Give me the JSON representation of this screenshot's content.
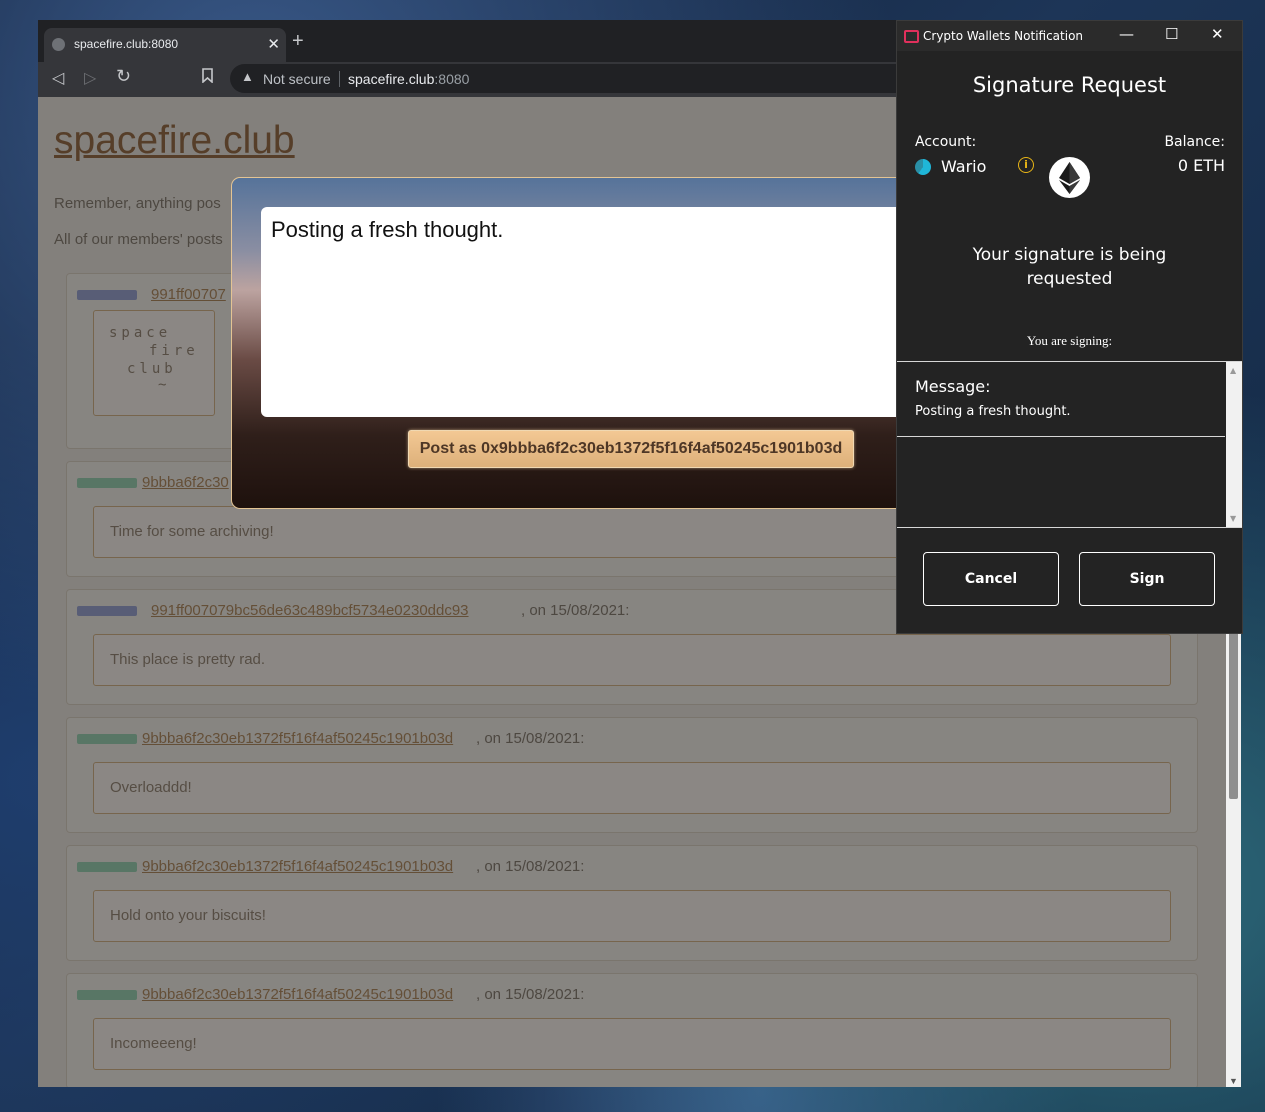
{
  "browser": {
    "tab_title": "spacefire.club:8080",
    "tab_close": "✕",
    "new_tab": "+",
    "not_secure": "Not secure",
    "url_host": "spacefire.club",
    "url_port": ":8080"
  },
  "site": {
    "title": "spacefire.club",
    "intro1": "Remember, anything pos",
    "intro2": "All of our members' posts"
  },
  "ascii_art": [
    "space",
    "fire",
    "club",
    "~"
  ],
  "posts": [
    {
      "address": "991ff00707",
      "date": "",
      "message": "",
      "avatar_color": "#8f97c7"
    },
    {
      "address": "9bbba6f2c30",
      "date": "",
      "message": "Time for some archiving!",
      "avatar_color": "#8ec7a8"
    },
    {
      "address": "991ff007079bc56de63c489bcf5734e0230ddc93",
      "date": ", on 15/08/2021:",
      "message": "This place is pretty rad.",
      "avatar_color": "#8f97c7"
    },
    {
      "address": "9bbba6f2c30eb1372f5f16f4af50245c1901b03d",
      "date": ", on 15/08/2021:",
      "message": "Overloaddd!",
      "avatar_color": "#8ec7a8"
    },
    {
      "address": "9bbba6f2c30eb1372f5f16f4af50245c1901b03d",
      "date": ", on 15/08/2021:",
      "message": "Hold onto your biscuits!",
      "avatar_color": "#8ec7a8"
    },
    {
      "address": "9bbba6f2c30eb1372f5f16f4af50245c1901b03d",
      "date": ", on 15/08/2021:",
      "message": "Incomeeeng!",
      "avatar_color": "#8ec7a8"
    }
  ],
  "compose": {
    "text": "Posting a fresh thought.",
    "post_button": "Post as 0x9bbba6f2c30eb1372f5f16f4af50245c1901b03d"
  },
  "wallet": {
    "window_title": "Crypto Wallets Notification",
    "minimize": "—",
    "maximize": "☐",
    "close": "✕",
    "heading": "Signature Request",
    "account_label": "Account:",
    "account_name": "Wario",
    "balance_label": "Balance:",
    "balance_value": "0 ETH",
    "requested_text": "Your signature is being requested",
    "signing_label": "You are signing:",
    "message_label": "Message:",
    "message_value": "Posting a fresh thought.",
    "cancel": "Cancel",
    "sign": "Sign"
  }
}
